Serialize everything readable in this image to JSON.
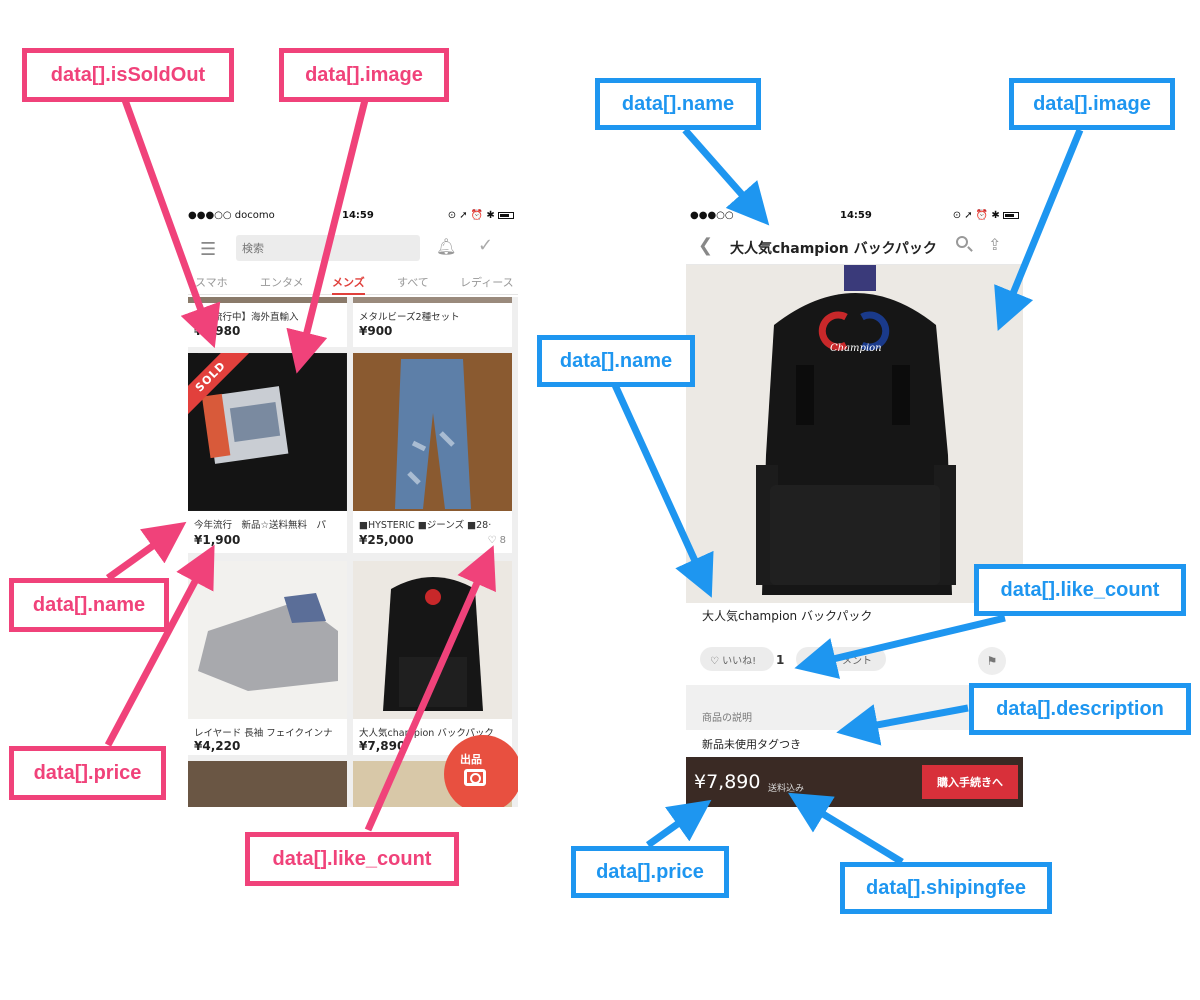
{
  "colors": {
    "annot_pink": "#f0427a",
    "annot_blue": "#1e96f0",
    "accent_red": "#e0403c",
    "buybar_bg": "#3a2a24"
  },
  "annotations": {
    "left": [
      "data[].isSoldOut",
      "data[].image",
      "data[].name",
      "data[].price",
      "data[].like_count"
    ],
    "right": [
      "data[].name",
      "data[].image",
      "data[].name",
      "data[].like_count",
      "data[].description",
      "data[].price",
      "data[].shipingfee"
    ]
  },
  "left_phone": {
    "status": {
      "carrier": "●●●○○ docomo",
      "time": "14:59",
      "indicators": "⊙ ➚ ⏰ ✱"
    },
    "search_placeholder": "検索",
    "tabs": [
      "・スマホ",
      "エンタメ",
      "メンズ",
      "すべて",
      "レディース"
    ],
    "items": [
      {
        "name": "【大流行中】海外直輸入",
        "price": "¥2,980"
      },
      {
        "name": "メタルビーズ2種セット",
        "price": "¥900"
      },
      {
        "name": "今年流行　新品☆送料無料　パ",
        "price": "¥1,900",
        "sold_label": "SOLD"
      },
      {
        "name": "■HYSTERIC ■ジーンズ ■28·",
        "price": "¥25,000",
        "like_count": "8"
      },
      {
        "name": "レイヤード 長袖 フェイクインナ",
        "price": "¥4,220"
      },
      {
        "name": "大人気champion バックパック",
        "price": "¥7,890"
      }
    ],
    "sell_label": "出品"
  },
  "right_phone": {
    "status": {
      "carrier": "●●●○○",
      "time": "14:59",
      "indicators": "⊙ ➚ ⏰ ✱"
    },
    "title": "大人気champion バックパック",
    "brand_text": "Champion",
    "name": "大人気champion バックパック",
    "like_label": "いいね!",
    "like_count": "1",
    "comment_label": "メント",
    "desc_heading": "商品の説明",
    "desc_text": "新品未使用タグつき",
    "price": "¥7,890",
    "shipping": "送料込み",
    "buy_label": "購入手続きへ"
  }
}
